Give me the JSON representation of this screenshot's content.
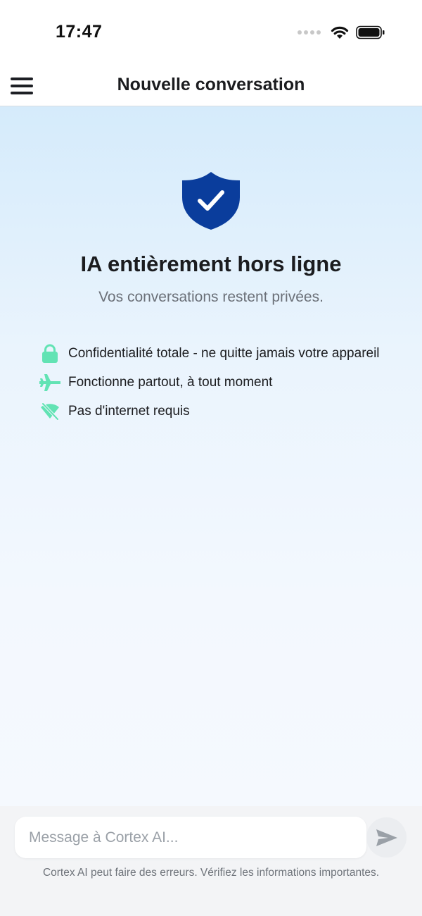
{
  "status_bar": {
    "time": "17:47",
    "icons": [
      "cellular-signal-icon",
      "wifi-icon",
      "battery-icon"
    ]
  },
  "nav": {
    "menu_icon": "hamburger-menu-icon",
    "title": "Nouvelle conversation"
  },
  "hero": {
    "icon": "shield-check-icon",
    "icon_color": "#0a3d9c",
    "headline": "IA entièrement hors ligne",
    "subtitle": "Vos conversations restent privées."
  },
  "features": {
    "accent_color": "#62e3b4",
    "items": [
      {
        "icon": "lock-icon",
        "label": "Confidentialité totale - ne quitte jamais votre appareil"
      },
      {
        "icon": "airplane-icon",
        "label": "Fonctionne partout, à tout moment"
      },
      {
        "icon": "wifi-off-icon",
        "label": "Pas d'internet requis"
      }
    ]
  },
  "composer": {
    "placeholder": "Message à Cortex AI...",
    "value": "",
    "send_icon": "send-icon",
    "disclaimer": "Cortex AI peut faire des erreurs. Vérifiez les informations importantes."
  }
}
